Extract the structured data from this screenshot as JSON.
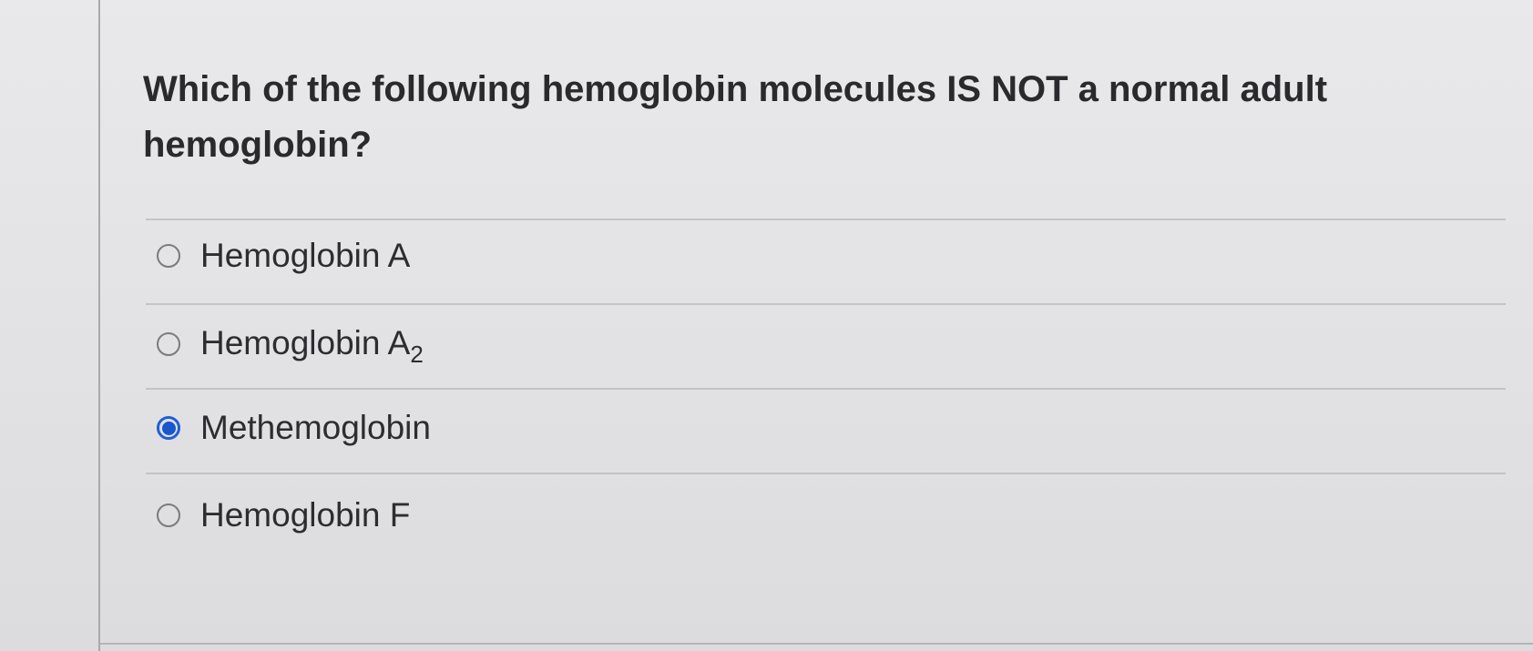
{
  "question": {
    "text": "Which of the following hemoglobin molecules IS NOT a normal adult hemoglobin?"
  },
  "options": [
    {
      "label": "Hemoglobin A",
      "subscript": "",
      "selected": false
    },
    {
      "label": "Hemoglobin A",
      "subscript": "2",
      "selected": false
    },
    {
      "label": "Methemoglobin",
      "subscript": "",
      "selected": true
    },
    {
      "label": "Hemoglobin F",
      "subscript": "",
      "selected": false
    }
  ],
  "colors": {
    "selected_radio": "#1a56cc",
    "radio_border": "#7a7a80",
    "divider": "#c4c4c7"
  }
}
